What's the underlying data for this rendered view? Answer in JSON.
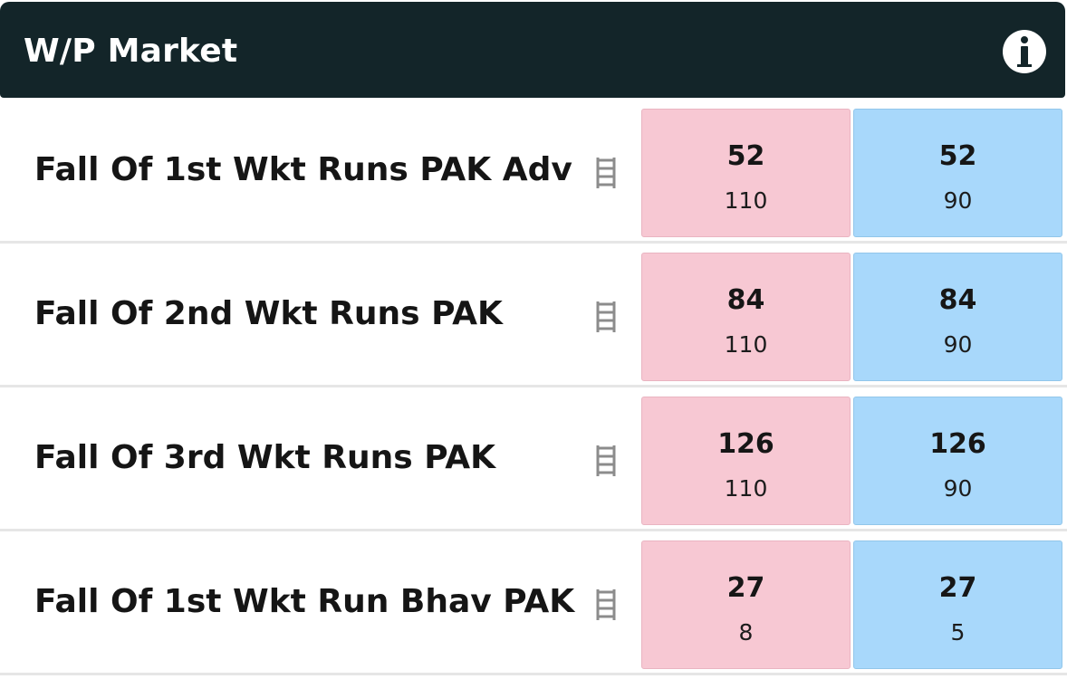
{
  "header": {
    "title": "W/P Market",
    "info_icon": "info-icon"
  },
  "colors": {
    "header_bg": "#132529",
    "lay_bg": "#f7c8d3",
    "back_bg": "#a8d8fb"
  },
  "rows": [
    {
      "label": "Fall Of 1st Wkt Runs PAK Adv",
      "ladder_icon": "ladder-icon",
      "lay": {
        "value": "52",
        "rate": "110"
      },
      "back": {
        "value": "52",
        "rate": "90"
      }
    },
    {
      "label": "Fall Of 2nd Wkt Runs PAK",
      "ladder_icon": "ladder-icon",
      "lay": {
        "value": "84",
        "rate": "110"
      },
      "back": {
        "value": "84",
        "rate": "90"
      }
    },
    {
      "label": "Fall Of 3rd Wkt Runs PAK",
      "ladder_icon": "ladder-icon",
      "lay": {
        "value": "126",
        "rate": "110"
      },
      "back": {
        "value": "126",
        "rate": "90"
      }
    },
    {
      "label": "Fall Of 1st Wkt Run Bhav PAK",
      "ladder_icon": "ladder-icon",
      "lay": {
        "value": "27",
        "rate": "8"
      },
      "back": {
        "value": "27",
        "rate": "5"
      }
    }
  ]
}
